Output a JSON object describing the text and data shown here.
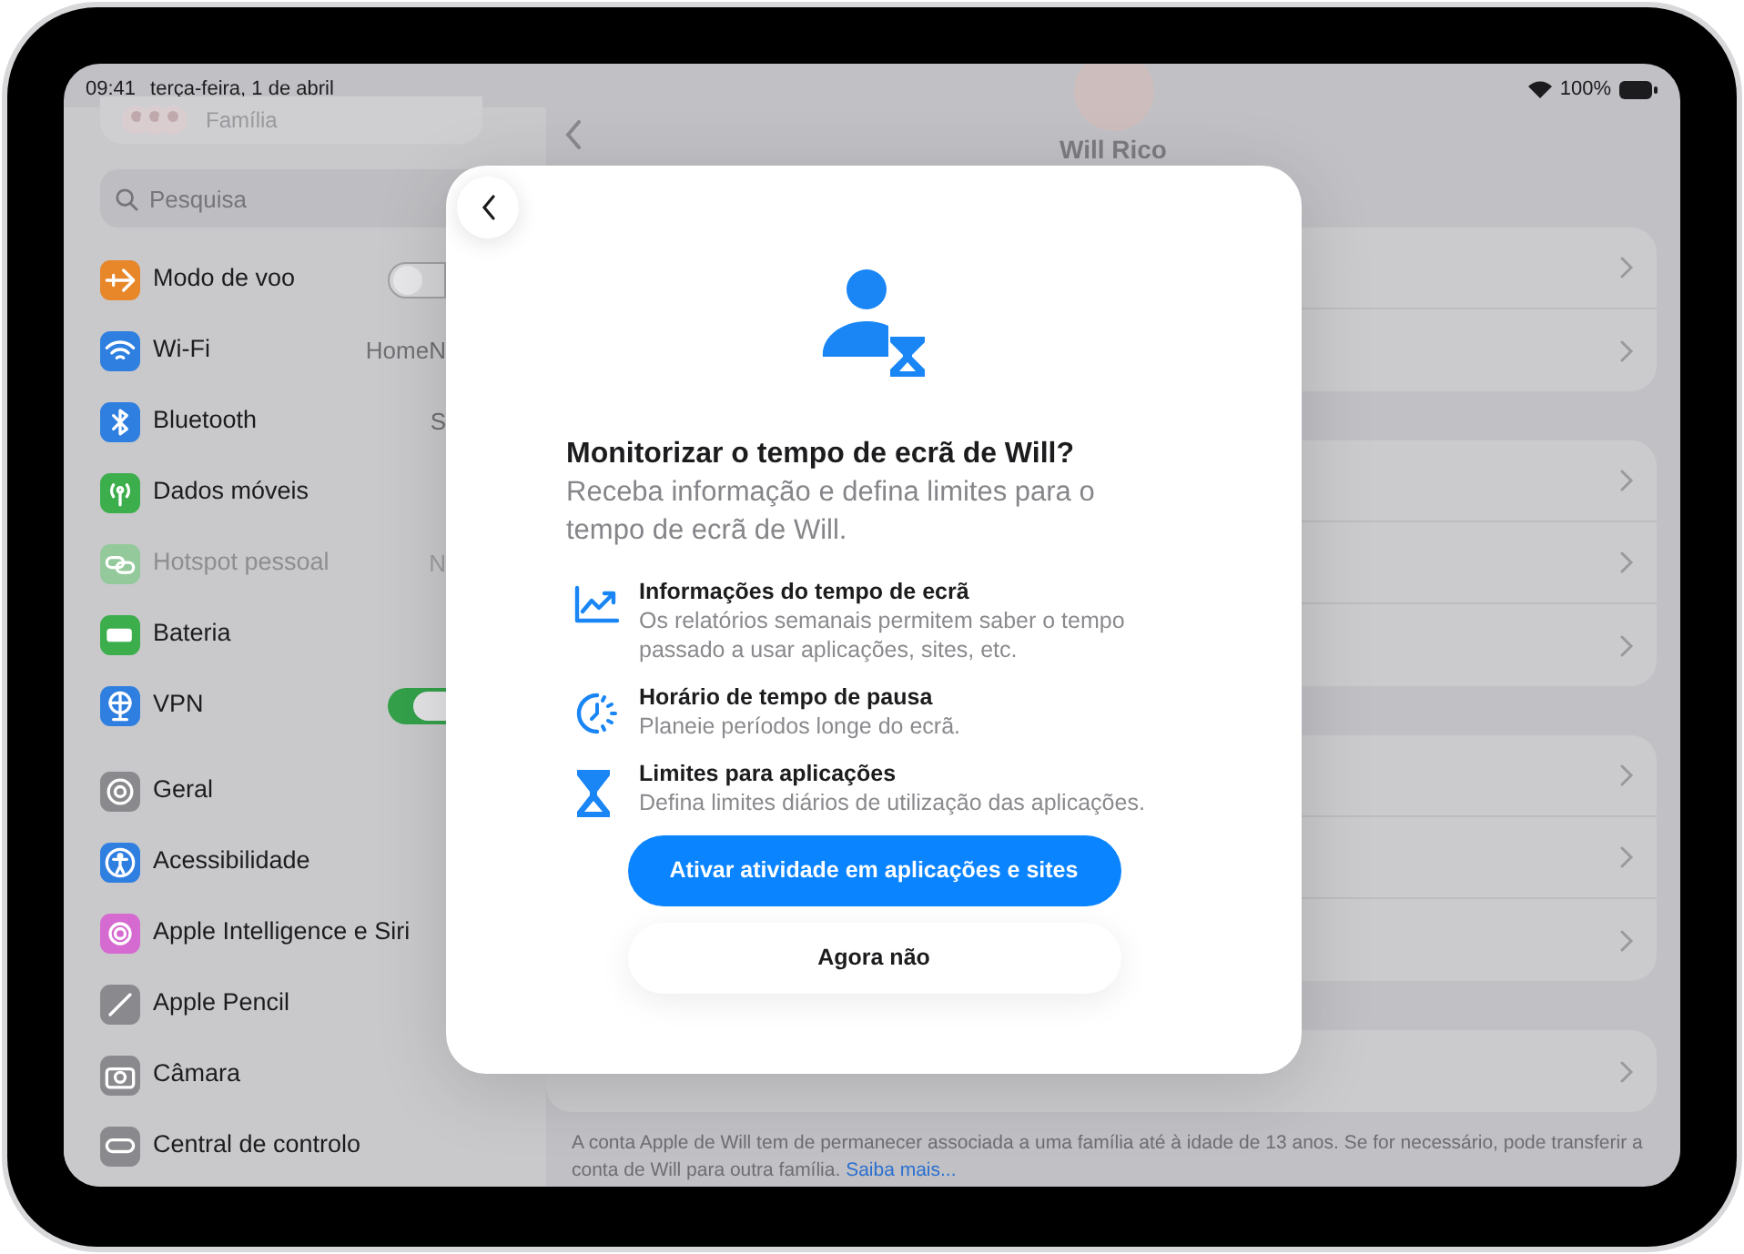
{
  "status_bar": {
    "time": "09:41",
    "date": "terça-feira, 1 de abril",
    "battery": "100%"
  },
  "sidebar": {
    "account": "Família",
    "search": {
      "placeholder": "Pesquisa"
    },
    "groups": [
      [
        {
          "label": "Modo de voo",
          "color": "#e8862a",
          "kind": "toggle",
          "on": false
        },
        {
          "label": "Wi-Fi",
          "color": "#2f7fe0",
          "kind": "value",
          "value": "HomeN"
        },
        {
          "label": "Bluetooth",
          "color": "#2f7fe0",
          "kind": "value",
          "value": "S"
        },
        {
          "label": "Dados móveis",
          "color": "#3cae4c",
          "kind": "plain"
        },
        {
          "label": "Hotspot pessoal",
          "color": "#93c99b",
          "kind": "value",
          "value": "N",
          "disabled": true
        },
        {
          "label": "Bateria",
          "color": "#3cae4c",
          "kind": "plain"
        },
        {
          "label": "VPN",
          "color": "#2f7fe0",
          "kind": "toggle",
          "on": true
        }
      ],
      [
        {
          "label": "Geral",
          "color": "#8a8a8e",
          "kind": "plain"
        },
        {
          "label": "Acessibilidade",
          "color": "#2f7fe0",
          "kind": "plain"
        },
        {
          "label": "Apple Intelligence e Siri",
          "color": "#d56ad0",
          "kind": "plain"
        },
        {
          "label": "Apple Pencil",
          "color": "#8a8a8e",
          "kind": "plain"
        },
        {
          "label": "Câmara",
          "color": "#8a8a8e",
          "kind": "plain"
        },
        {
          "label": "Central de controlo",
          "color": "#8a8a8e",
          "kind": "plain"
        }
      ]
    ]
  },
  "detail": {
    "name": "Will Rico",
    "footnote": "A conta Apple de Will tem de permanecer associada a uma família até à idade de 13 anos. Se for necessário, pode transferir a conta de Will para outra família.",
    "footnote_link": "Saiba mais..."
  },
  "dialog": {
    "title": "Monitorizar o tempo de ecrã de Will?",
    "subtitle": "Receba informação e defina limites para o tempo de ecrã de Will.",
    "features": [
      {
        "title": "Informações do tempo de ecrã",
        "text": "Os relatórios semanais permitem saber o tempo passado a usar aplicações, sites, etc."
      },
      {
        "title": "Horário de tempo de pausa",
        "text": "Planeie períodos longe do ecrã."
      },
      {
        "title": "Limites para aplicações",
        "text": "Defina limites diários de utilização das aplicações."
      }
    ],
    "primary_button": "Ativar atividade em aplicações e sites",
    "secondary_button": "Agora não"
  }
}
